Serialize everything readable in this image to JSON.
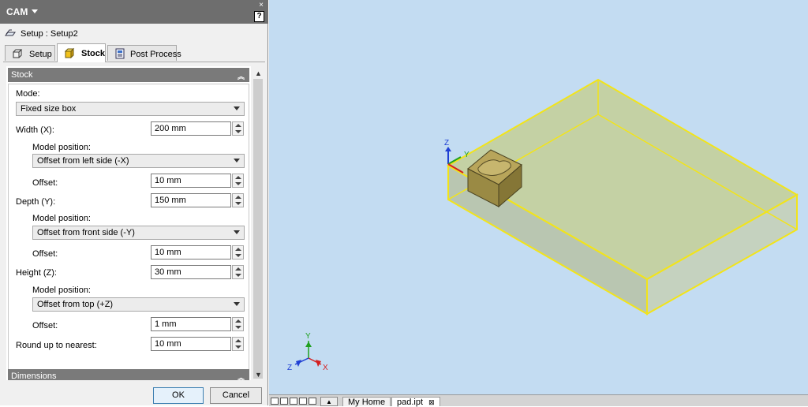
{
  "panel": {
    "title": "CAM",
    "help_label": "?",
    "close_label": "×",
    "setup_label": "Setup : Setup2",
    "tabs": [
      {
        "label": "Setup",
        "icon": "setup-box-icon",
        "active": false
      },
      {
        "label": "Stock",
        "icon": "stock-cube-icon",
        "active": true
      },
      {
        "label": "Post Process",
        "icon": "post-process-icon",
        "active": false
      }
    ]
  },
  "stock": {
    "section_title": "Stock",
    "mode_label": "Mode:",
    "mode_value": "Fixed size box",
    "width_label": "Width (X):",
    "width_value": "200 mm",
    "width_model_position_label": "Model position:",
    "width_model_position_value": "Offset from left side (-X)",
    "width_offset_label": "Offset:",
    "width_offset_value": "10 mm",
    "depth_label": "Depth (Y):",
    "depth_value": "150 mm",
    "depth_model_position_label": "Model position:",
    "depth_model_position_value": "Offset from front side (-Y)",
    "depth_offset_label": "Offset:",
    "depth_offset_value": "10 mm",
    "height_label": "Height (Z):",
    "height_value": "30 mm",
    "height_model_position_label": "Model position:",
    "height_model_position_value": "Offset from top (+Z)",
    "height_offset_label": "Offset:",
    "height_offset_value": "1 mm",
    "round_label": "Round up to nearest:",
    "round_value": "10 mm"
  },
  "dimensions": {
    "section_title": "Dimensions"
  },
  "buttons": {
    "ok": "OK",
    "cancel": "Cancel"
  },
  "viewport": {
    "axis_x": "X",
    "axis_y": "Y",
    "axis_z": "Z",
    "stock_outline_color": "#f2e41a",
    "background_color": "#c3dcf2"
  },
  "bottom_tabs": [
    {
      "label": "My Home"
    },
    {
      "label": "pad.ipt",
      "close": "⊠"
    }
  ],
  "colors": {
    "panel_header": "#6e6e6e",
    "section_header": "#7a7a7a",
    "axis_red": "#d42020",
    "axis_green": "#1fa01f",
    "axis_blue": "#1f3fd4"
  }
}
